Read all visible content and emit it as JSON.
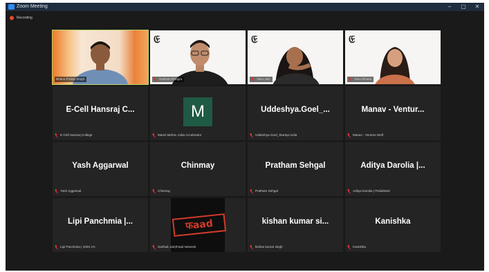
{
  "window": {
    "title": "Zoom Meeting",
    "controls": [
      "–",
      "▢",
      "✕"
    ]
  },
  "recording": {
    "label": "Recording"
  },
  "tiles": [
    {
      "kind": "video",
      "name": "Bhanu Pratap Singh",
      "active": true
    },
    {
      "kind": "video",
      "name": "Sarthak Dhingra"
    },
    {
      "kind": "video",
      "name": "Vasu Jain"
    },
    {
      "kind": "video",
      "name": "Tanvi Bhatia"
    },
    {
      "kind": "text",
      "display": "E-Cell Hansraj C...",
      "name": "E-Cell Hansraj College"
    },
    {
      "kind": "avatar",
      "avatar_letter": "M",
      "name": "Manvi Mehra, India Accelerator"
    },
    {
      "kind": "text",
      "display": "Uddeshya.Goel_...",
      "name": "Uddeshya.Goel_Startup India"
    },
    {
      "kind": "text",
      "display": "Manav - Ventur...",
      "name": "Manav - Venture Wolf"
    },
    {
      "kind": "text",
      "display": "Yash Aggarwal",
      "name": "Yash Aggarwal"
    },
    {
      "kind": "text",
      "display": "Chinmay",
      "name": "Chinmay"
    },
    {
      "kind": "text",
      "display": "Pratham Sehgal",
      "name": "Pratham Sehgal"
    },
    {
      "kind": "text",
      "display": "Aditya Darolia |...",
      "name": "Aditya Darolia | PedalStart"
    },
    {
      "kind": "text",
      "display": "Lipi Panchmia |...",
      "name": "Lipi Panchmia | 100X.VC"
    },
    {
      "kind": "logo",
      "logo_text": "फaad",
      "name": "Sarthak Jain|Faad Network"
    },
    {
      "kind": "text",
      "display": "kishan kumar si...",
      "name": "kishan kumar singh"
    },
    {
      "kind": "text",
      "display": "Kanishka",
      "name": "Kanishka"
    }
  ],
  "colors": {
    "mic_muted": "#d7352c",
    "active_speaker": "#b8d66a",
    "avatar_bg": "#1f5a44",
    "faad_red": "#d33b2a"
  }
}
